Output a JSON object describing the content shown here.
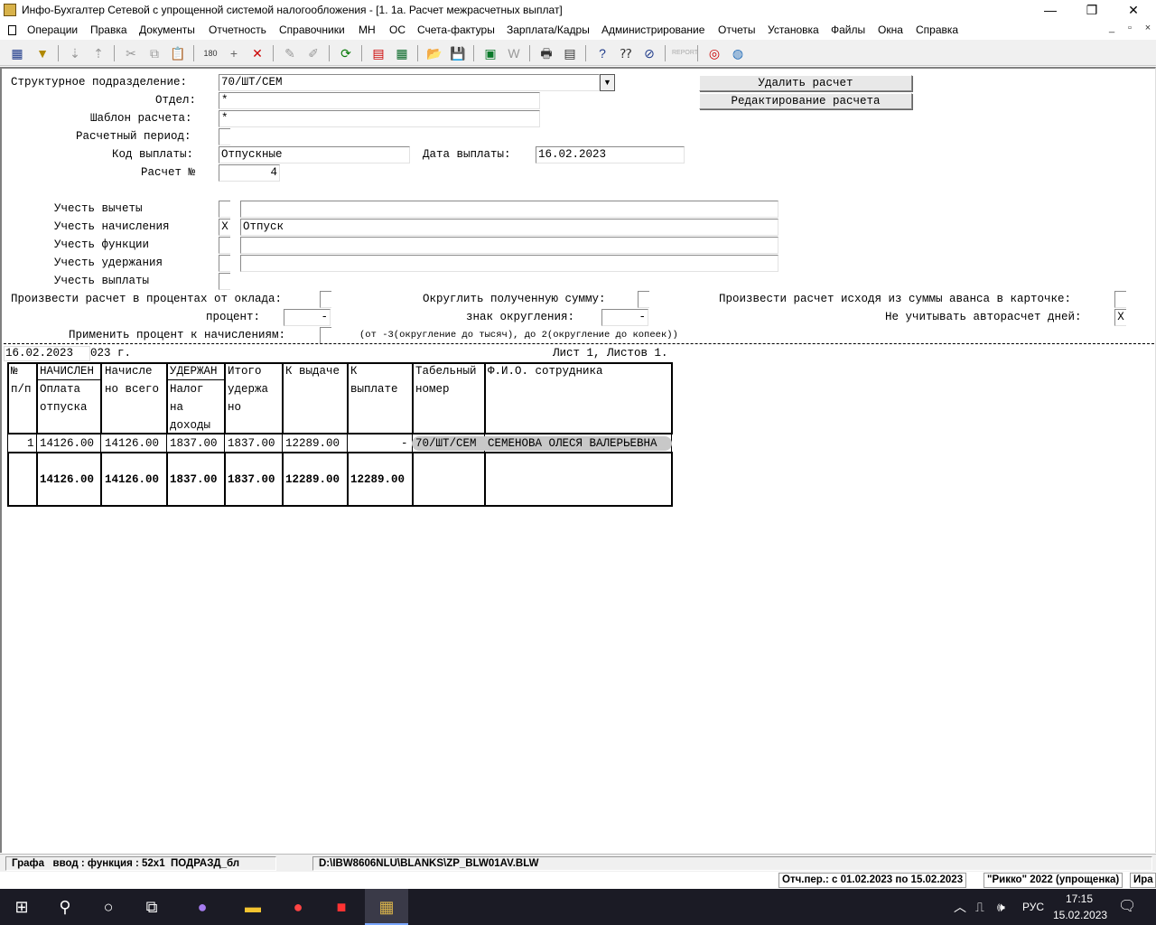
{
  "window": {
    "title": "Инфо-Бухгалтер Сетевой с упрощенной системой налогообложения - [1. 1а. Расчет межрасчетных выплат]",
    "minimize": "—",
    "restore": "❐",
    "close": "✕"
  },
  "menu": [
    "Операции",
    "Правка",
    "Документы",
    "Отчетность",
    "Справочники",
    "МН",
    "ОС",
    "Счета-фактуры",
    "Зарплата/Кадры",
    "Администрирование",
    "Отчеты",
    "Установка",
    "Файлы",
    "Окна",
    "Справка"
  ],
  "mdi_controls": [
    "_",
    "▫",
    "×"
  ],
  "form": {
    "struct_label": "Структурное подразделение:",
    "struct_value": "70/ШТ/СЕМ",
    "dept_label": "Отдел:",
    "dept_value": "*",
    "template_label": "Шаблон расчета:",
    "template_value": "*",
    "period_label": "Расчетный период:",
    "paycode_label": "Код выплаты:",
    "paycode_value": "Отпускные",
    "paydate_label": "Дата выплаты:",
    "paydate_value": "16.02.2023",
    "calcno_label": "Расчет №",
    "calcno_value": "4",
    "delete_button": "Удалить расчет",
    "edit_button": "Редактирование расчета",
    "options": [
      {
        "label": "Учесть вычеты",
        "checked": "",
        "value": ""
      },
      {
        "label": "Учесть начисления",
        "checked": "X",
        "value": "Отпуск"
      },
      {
        "label": "Учесть функции",
        "checked": "",
        "value": ""
      },
      {
        "label": "Учесть удержания",
        "checked": "",
        "value": ""
      },
      {
        "label": "Учесть выплаты",
        "checked": "",
        "value": ""
      }
    ],
    "percent_calc_label": "Произвести расчет в процентах от оклада:",
    "percent_label": "процент:",
    "percent_value": "-",
    "round_label": "Округлить полученную сумму:",
    "round_sign_label": "знак округления:",
    "round_sign_value": "-",
    "advance_label": "Произвести расчет исходя из суммы аванса в карточке:",
    "autodays_label": "Не учитывать авторасчет дней:",
    "autodays_value": "X",
    "apply_percent_label": "Применить процент к начислениям:",
    "round_hint": "(от -3(округление до тысяч), до 2(округление до копеек))"
  },
  "report": {
    "date_field": "16.02.2023",
    "date_suffix": "023 г.",
    "sheet_info": "Лист 1, Листов 1.",
    "headers": {
      "num1": "№",
      "num2": "п/п",
      "accr_group": "НАЧИСЛЕН",
      "accr1": "Оплата",
      "accr2": "отпуска",
      "total1": "Начисле",
      "total2": "но всего",
      "ded_group": "УДЕРЖАН",
      "ded1": "Налог",
      "ded2": "на",
      "ded3": "доходы",
      "dedtotal1": "Итого",
      "dedtotal2": "удержа",
      "dedtotal3": "но",
      "issue1": "К выдаче",
      "pay1": "К",
      "pay2": "выплате",
      "tab1": "Табельный",
      "tab2": "номер",
      "fio1": "Ф.И.О. сотрудника"
    },
    "row": {
      "num": "1",
      "accr": "14126.00",
      "total": "14126.00",
      "ded": "1837.00",
      "dedtotal": "1837.00",
      "issue": "12289.00",
      "pay": "-",
      "tab": "70/ШТ/СЕМ",
      "fio": "СЕМЕНОВА ОЛЕСЯ ВАЛЕРЬЕВНА"
    },
    "totals": {
      "accr": "14126.00",
      "total": "14126.00",
      "ded": "1837.00",
      "dedtotal": "1837.00",
      "issue": "12289.00",
      "pay": "12289.00"
    }
  },
  "status": {
    "mode": "Графа   ввод : функция : 52x1  ПОДРАЗД_бл",
    "path": "D:\\IBW8606NLU\\BLANKS\\ZP_BLW01AV.BLW",
    "period": "Отч.пер.: с 01.02.2023 по 15.02.2023",
    "company": "\"Рикко\" 2022 (упрощенка)",
    "user": "Ира"
  },
  "taskbar": {
    "lang": "РУС",
    "time": "17:15",
    "date": "15.02.2023"
  }
}
